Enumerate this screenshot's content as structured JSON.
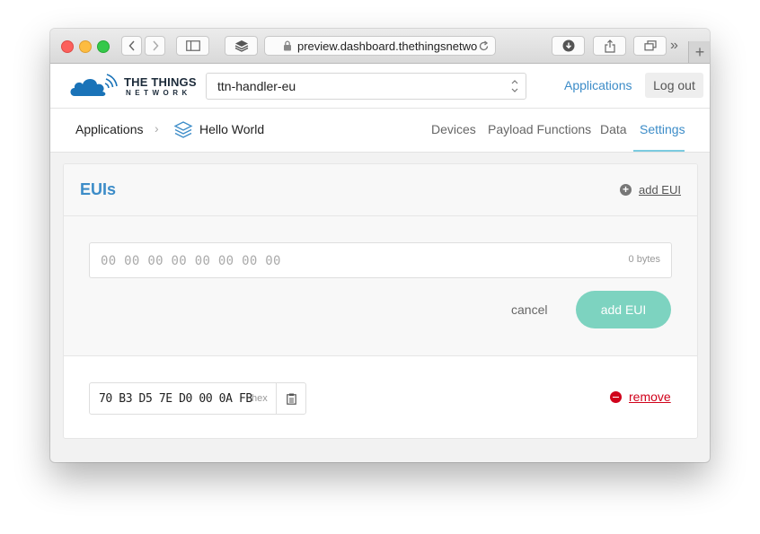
{
  "browser": {
    "url_text": "preview.dashboard.thethingsnetwo",
    "back_icon": "chevron-left-icon",
    "forward_icon": "chevron-right-icon",
    "new_tab_label": "+",
    "overflow_label": "»"
  },
  "header": {
    "logo_line1": "THE THINGS",
    "logo_line2": "NETWORK",
    "handler_select_value": "ttn-handler-eu",
    "applications_link": "Applications",
    "logout_label": "Log out"
  },
  "breadcrumb": {
    "root": "Applications",
    "separator": "›",
    "current": "Hello World"
  },
  "tabs": [
    {
      "label": "Devices"
    },
    {
      "label": "Payload Functions"
    },
    {
      "label": "Data"
    },
    {
      "label": "Settings"
    }
  ],
  "euis": {
    "title": "EUIs",
    "add_link": "add EUI",
    "input_placeholder": "00 00 00 00 00 00 00 00",
    "bytes_label": "0 bytes",
    "cancel_label": "cancel",
    "submit_label": "add EUI",
    "items": [
      {
        "value": "70 B3 D5 7E D0 00 0A FB",
        "format": "hex",
        "remove_label": "remove"
      }
    ]
  },
  "colors": {
    "accent": "#3c8cc8",
    "submit_button": "#7dd3c0",
    "danger": "#d0021b"
  }
}
